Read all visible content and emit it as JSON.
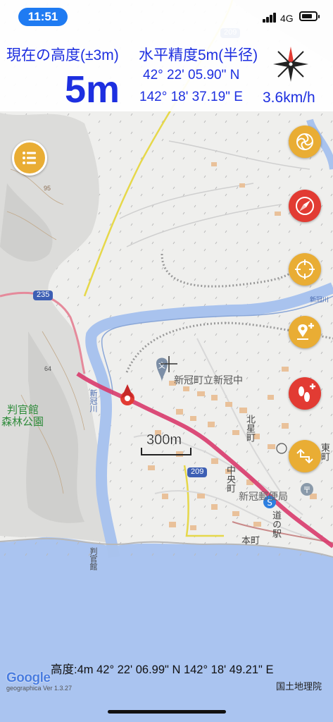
{
  "status_bar": {
    "time": "11:51",
    "network": "4G",
    "battery_level": 0.8
  },
  "hud": {
    "altitude_label": "現在の高度(±3m)",
    "altitude_value": "5m",
    "accuracy_label": "水平精度5m(半径)",
    "latitude": "42° 22' 05.90\" N",
    "longitude": "142° 18' 37.19\" E",
    "speed": "3.6km/h"
  },
  "map_labels": {
    "road_209_top": "209",
    "road_209_bottom": "209",
    "road_235": "235",
    "contour_95": "95",
    "contour_64": "64",
    "park_line1": "判官館",
    "park_line2": "森林公園",
    "school": "新冠町立新冠中",
    "north_town": "北星町",
    "east_town": "東町",
    "central_town": "中央町",
    "post_office": "新冠郵便局",
    "michinoeki": "道の駅",
    "hon_town": "本町",
    "cape": "判官館",
    "river": "新冠川",
    "river_small": "新冠川",
    "scale": "300m"
  },
  "buttons": [
    {
      "name": "layers-button",
      "color": "#e9ad34",
      "icon": "spiral-icon"
    },
    {
      "name": "compass-button",
      "color": "#e23b33",
      "icon": "compass-needle-icon"
    },
    {
      "name": "locate-button",
      "color": "#e9ad34",
      "icon": "crosshair-icon"
    },
    {
      "name": "add-place-button",
      "color": "#e9ad34",
      "icon": "pin-add-icon"
    },
    {
      "name": "add-track-button",
      "color": "#e23b33",
      "icon": "footprints-add-icon"
    },
    {
      "name": "route-button",
      "color": "#e9ad34",
      "icon": "route-icon"
    }
  ],
  "footer": {
    "current_info": "高度:4m  42° 22' 06.99\" N 142° 18' 49.21\" E",
    "credit": "国土地理院",
    "google": "Google",
    "app_version": "geographica Ver 1.3.27"
  },
  "colors": {
    "hud_text": "#1d2fe0",
    "sea": "#aac4f0",
    "route": "#d83a6b",
    "yellow_fab": "#e9ad34",
    "red_fab": "#e23b33"
  }
}
